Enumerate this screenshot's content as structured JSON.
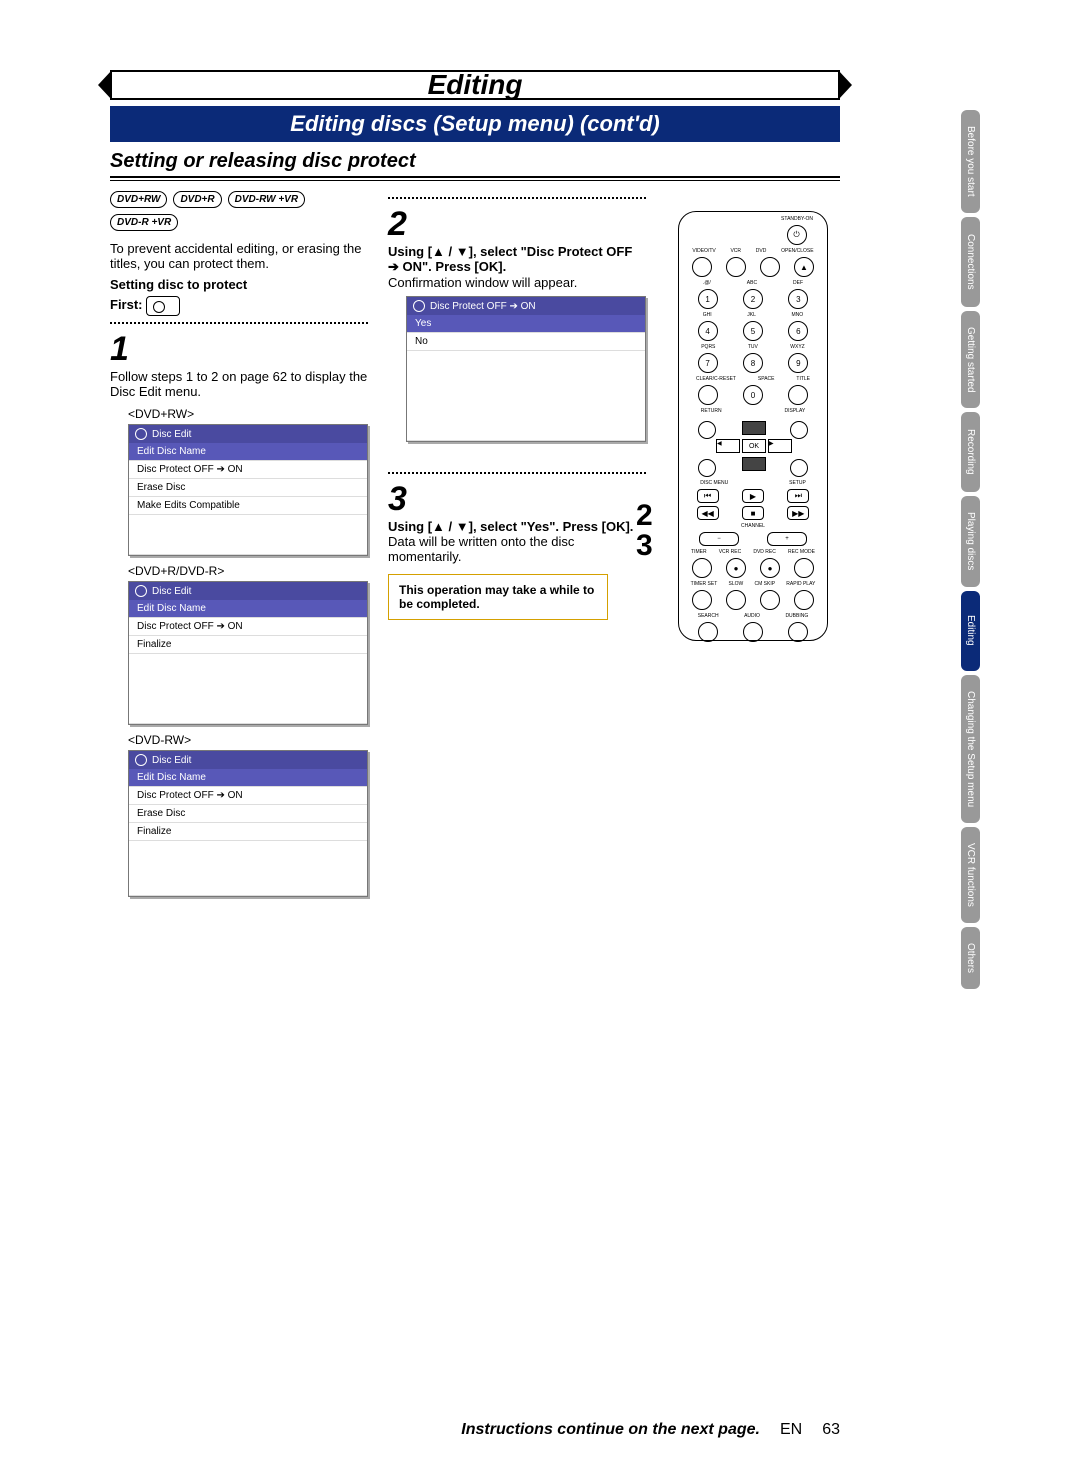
{
  "header": {
    "title": "Editing",
    "banner": "Editing discs (Setup menu) (cont'd)",
    "subhead": "Setting or releasing disc protect"
  },
  "disc_types": [
    "DVD+RW",
    "DVD+R",
    "DVD-RW +VR",
    "DVD-R +VR"
  ],
  "intro_text": "To prevent accidental editing, or erasing the titles, you can protect them.",
  "setting_label": "Setting disc to protect",
  "first_label": "First:",
  "step1": {
    "num": "1",
    "text": "Follow steps 1 to 2 on page 62 to display the Disc Edit menu."
  },
  "menus": {
    "dvdrw": {
      "label": "<DVD+RW>",
      "title": "Disc Edit",
      "items": [
        "Edit Disc Name",
        "Disc Protect OFF  ➔  ON",
        "Erase Disc",
        "Make Edits Compatible"
      ]
    },
    "dvdr": {
      "label": "<DVD+R/DVD-R>",
      "title": "Disc Edit",
      "items": [
        "Edit Disc Name",
        "Disc Protect OFF  ➔  ON",
        "Finalize"
      ]
    },
    "dvdrw_minus": {
      "label": "<DVD-RW>",
      "title": "Disc Edit",
      "items": [
        "Edit Disc Name",
        "Disc Protect OFF  ➔  ON",
        "Erase Disc",
        "Finalize"
      ]
    }
  },
  "step2": {
    "num": "2",
    "instr_pre": "Using [▲ / ▼], select \"Disc Protect OFF ",
    "instr_post": " ON\". Press [OK].",
    "confirm_text": "Confirmation window will appear.",
    "menu_title": "Disc Protect OFF  ➔  ON",
    "options": [
      "Yes",
      "No"
    ]
  },
  "step3": {
    "num": "3",
    "instr": "Using [▲ / ▼], select \"Yes\". Press [OK].",
    "result": "Data will be written onto the disc momentarily.",
    "note": "This operation may take a while to be completed."
  },
  "remote": {
    "standby": "STANDBY-ON",
    "top_row": [
      "VIDEO/TV",
      "VCR",
      "DVD",
      "OPEN/CLOSE"
    ],
    "num_labels": [
      ".@/",
      "ABC",
      "DEF",
      "GHI",
      "JKL",
      "MNO",
      "PQRS",
      "TUV",
      "WXYZ"
    ],
    "nums": [
      "1",
      "2",
      "3",
      "4",
      "5",
      "6",
      "7",
      "8",
      "9",
      "0"
    ],
    "bottom_labels": [
      "CLEAR/C-RESET",
      "SPACE",
      "TITLE"
    ],
    "nav": {
      "return": "RETURN",
      "display": "DISPLAY",
      "ok": "OK",
      "discmenu": "DISC MENU",
      "setup": "SETUP"
    },
    "transport": [
      "⏮",
      "▶",
      "⏭",
      "◀◀",
      "■",
      "▶▶"
    ],
    "channel": "CHANNEL",
    "ch_btns": [
      "−",
      "+"
    ],
    "rec_row1": [
      "TIMER",
      "VCR REC",
      "DVD REC",
      "REC MODE"
    ],
    "rec_row2": [
      "TIMER SET",
      "SLOW",
      "CM SKIP",
      "RAPID PLAY"
    ],
    "rec_row3": [
      "SEARCH",
      "AUDIO",
      "DUBBING"
    ]
  },
  "step_refs": {
    "a": "2",
    "b": "3"
  },
  "side_tabs": [
    "Before you start",
    "Connections",
    "Getting started",
    "Recording",
    "Playing discs",
    "Editing",
    "Changing the Setup menu",
    "VCR functions",
    "Others"
  ],
  "active_tab_index": 5,
  "footer": {
    "cont": "Instructions continue on the next page.",
    "lang": "EN",
    "page": "63"
  }
}
